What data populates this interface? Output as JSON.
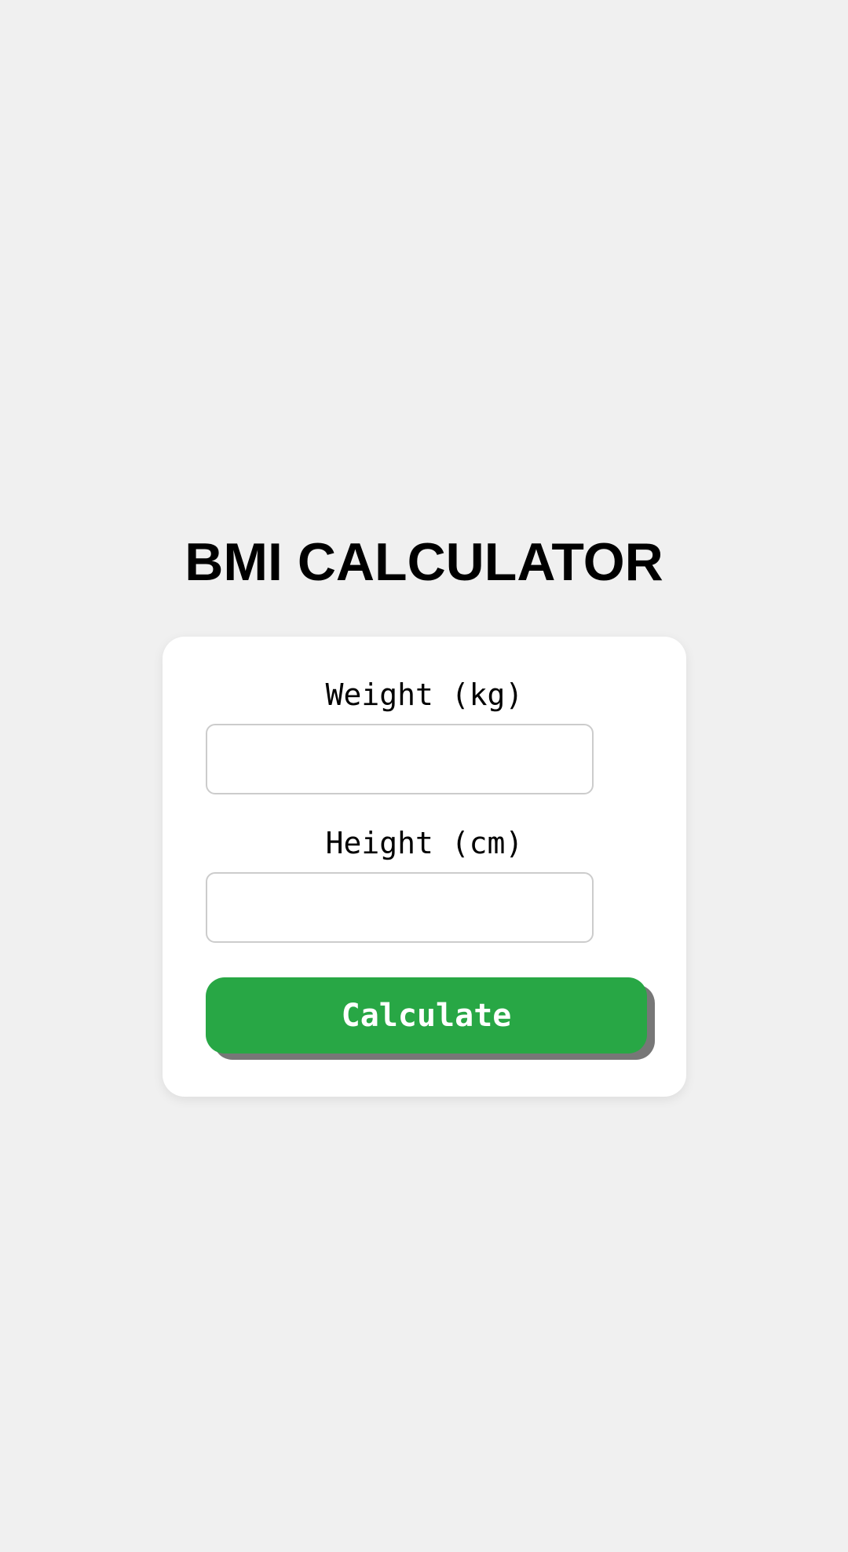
{
  "page": {
    "title": "BMI CALCULATOR"
  },
  "form": {
    "weight": {
      "label": "Weight (kg)",
      "value": "",
      "placeholder": ""
    },
    "height": {
      "label": "Height (cm)",
      "value": "",
      "placeholder": ""
    },
    "submit_label": "Calculate"
  },
  "colors": {
    "background": "#f0f0f0",
    "card": "#ffffff",
    "button": "#28a745",
    "button_text": "#ffffff",
    "button_shadow": "#777777",
    "input_border": "#cccccc"
  }
}
